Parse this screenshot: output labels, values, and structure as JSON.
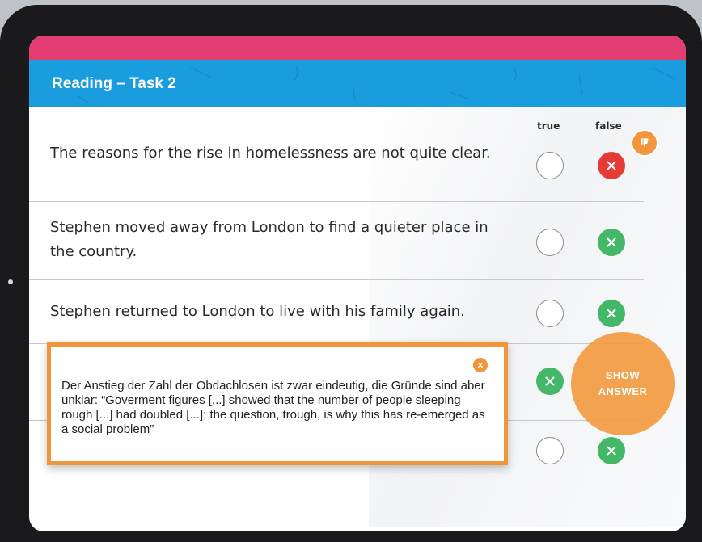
{
  "header": {
    "title": "Reading – Task 2"
  },
  "columns": {
    "true_label": "true",
    "false_label": "false"
  },
  "statements": [
    {
      "text": "The reasons for the rise in homelessness are not quite clear.",
      "true_state": "empty",
      "false_state": "red-x"
    },
    {
      "text": "Stephen moved away from London to find a quieter place in the country.",
      "true_state": "empty",
      "false_state": "green-x"
    },
    {
      "text": "Stephen returned to London to live with his family again.",
      "true_state": "empty",
      "false_state": "green-x"
    },
    {
      "text": "",
      "true_state": "green-x",
      "false_state": "hidden"
    },
    {
      "text": "",
      "true_state": "empty",
      "false_state": "green-x"
    }
  ],
  "popup": {
    "text": "Der Anstieg der Zahl der Obdachlosen ist zwar eindeutig, die Gründe sind aber unklar: “Goverment figures [...] showed that the number of people sleeping rough [...] had doubled [...]; the question, trough, is why this has re-emerged as a social problem”"
  },
  "show_answer": {
    "line1": "SHOW",
    "line2": "ANSWER"
  },
  "icons": {
    "feedback_badge": "thumbs-down-icon",
    "close": "close-icon",
    "mark": "x-icon"
  },
  "colors": {
    "header_blue": "#1a9ddf",
    "header_pink": "#e23d72",
    "correct_green": "#44b768",
    "wrong_red": "#e63a36",
    "accent_orange": "#f0953a"
  }
}
